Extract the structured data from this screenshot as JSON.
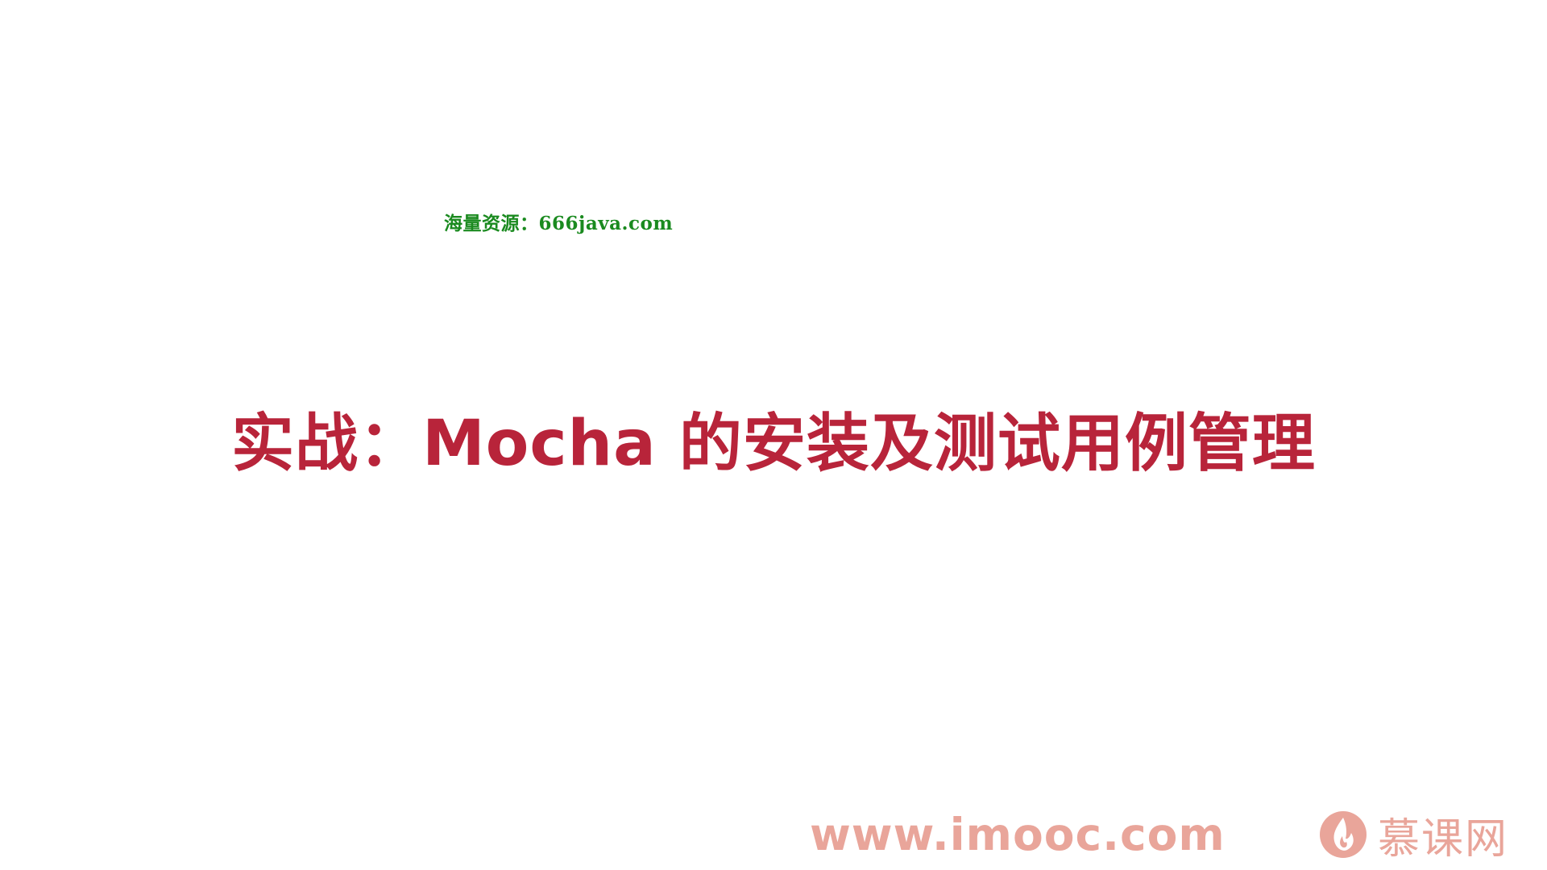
{
  "watermark": {
    "text": "海量资源：666java.com"
  },
  "slide": {
    "title": "实战：Mocha 的安装及测试用例管理"
  },
  "footer": {
    "url": "www.imooc.com",
    "brand_name": "慕课网",
    "brand_icon": "flame-logo-icon"
  },
  "colors": {
    "background": "#ffffff",
    "title": "#b8243a",
    "watermark": "#1a8a1f",
    "footer": "#e9a59a"
  }
}
